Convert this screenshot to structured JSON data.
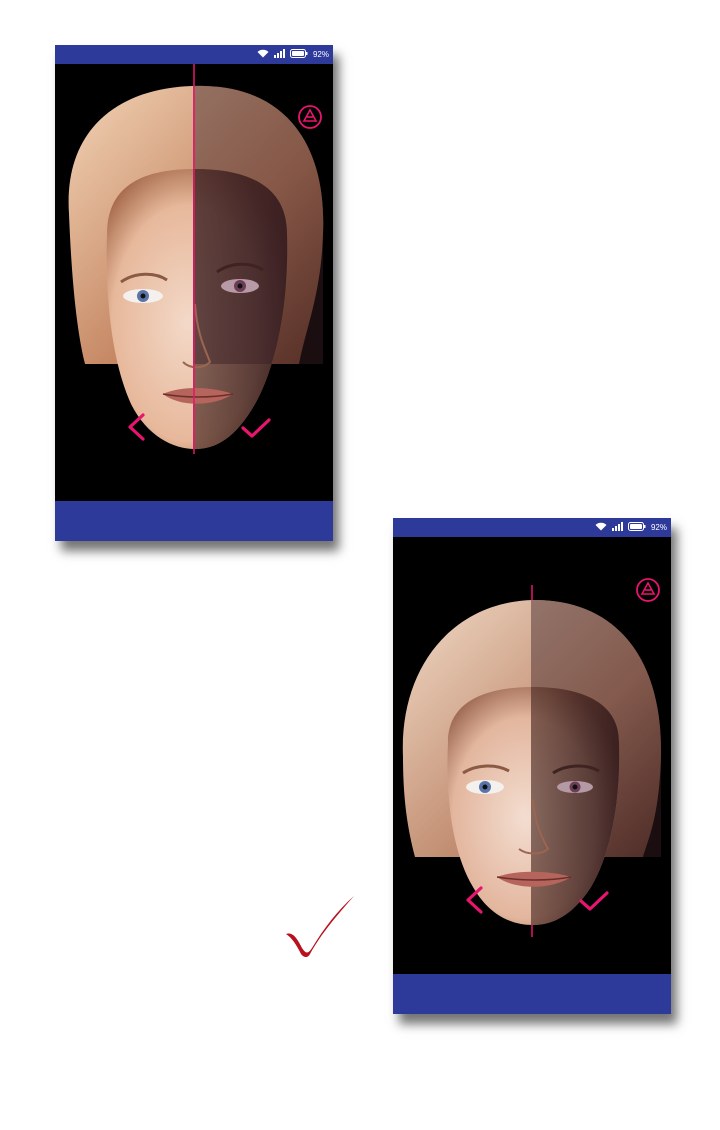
{
  "status": {
    "battery_percent": "92%"
  },
  "icons": {
    "wifi": "wifi-icon",
    "signal": "signal-icon",
    "battery": "battery-icon",
    "flip": "flip-face-icon",
    "back": "chevron-left-icon",
    "confirm": "check-icon",
    "result": "checkmark-icon"
  },
  "colors": {
    "bars": "#2e3a9a",
    "accent": "#e8156e",
    "background": "#000000",
    "check": "#b8101c"
  }
}
